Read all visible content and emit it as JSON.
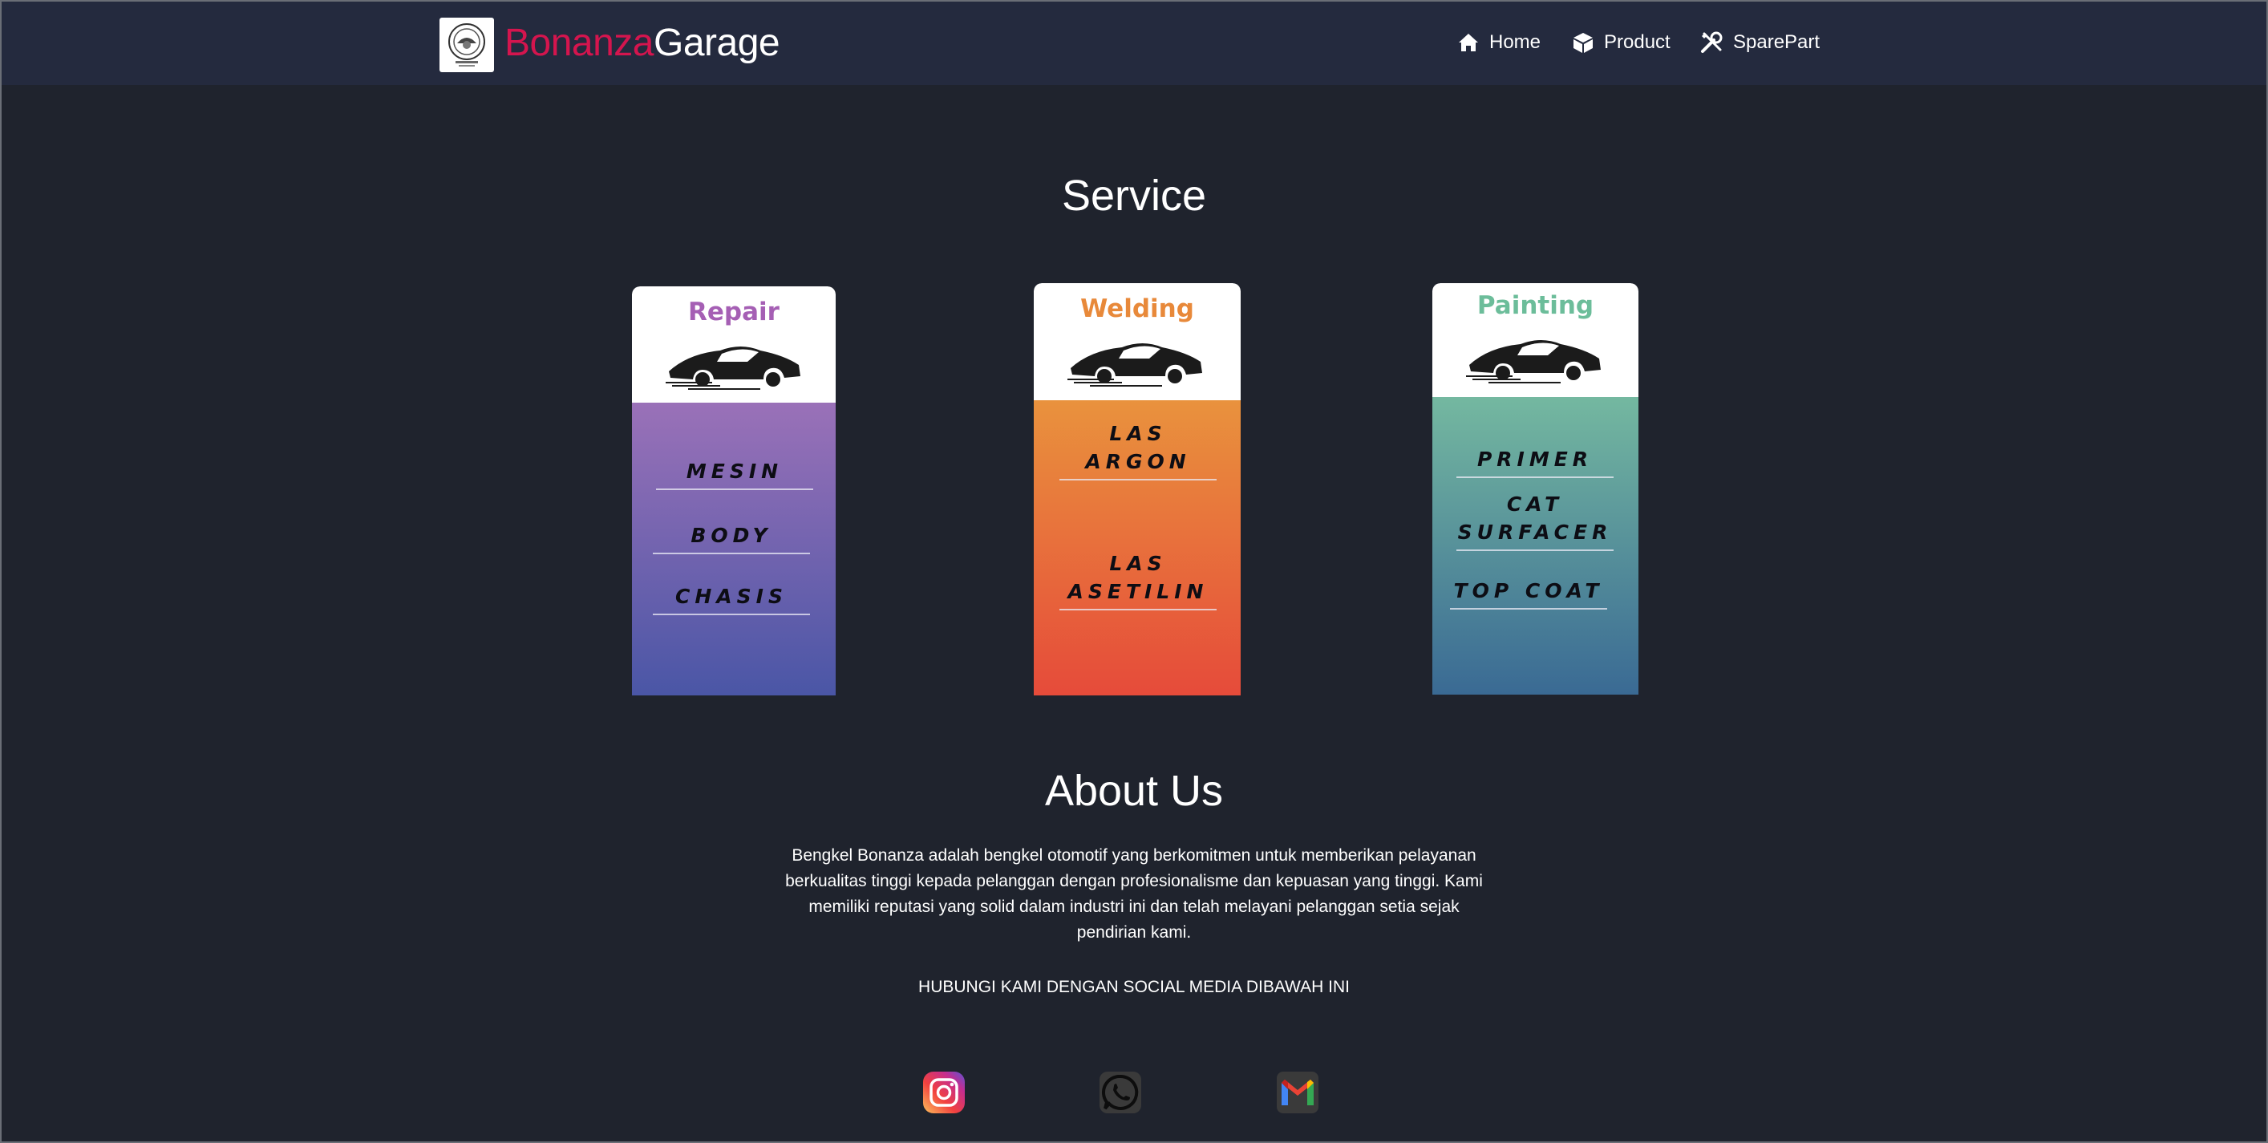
{
  "brand": {
    "part1": "Bonanza",
    "part2": "Garage",
    "accent_color": "#d4154e"
  },
  "nav": {
    "items": [
      {
        "label": "Home",
        "icon": "home-icon"
      },
      {
        "label": "Product",
        "icon": "box-icon"
      },
      {
        "label": "SparePart",
        "icon": "tools-icon"
      }
    ]
  },
  "service": {
    "title": "Service",
    "cards": [
      {
        "title": "Repair",
        "title_color": "#a55fb4",
        "icon": "car-icon",
        "items": [
          "MESIN",
          "BODY",
          "CHASIS"
        ]
      },
      {
        "title": "Welding",
        "title_color": "#e8893a",
        "icon": "car-icon",
        "items": [
          "LAS ARGON",
          "LAS ASETILIN"
        ]
      },
      {
        "title": "Painting",
        "title_color": "#6cbd9a",
        "icon": "car-icon",
        "items": [
          "PRIMER",
          "CAT SURFACER",
          "TOP COAT"
        ]
      }
    ]
  },
  "about": {
    "title": "About Us",
    "text": "Bengkel Bonanza adalah bengkel otomotif yang berkomitmen untuk memberikan pelayanan berkualitas tinggi kepada pelanggan dengan profesionalisme dan kepuasan yang tinggi. Kami memiliki reputasi yang solid dalam industri ini dan telah melayani pelanggan setia sejak pendirian kami.",
    "contact": "HUBUNGI KAMI DENGAN SOCIAL MEDIA DIBAWAH INI"
  },
  "social": [
    {
      "icon": "instagram-icon"
    },
    {
      "icon": "whatsapp-icon"
    },
    {
      "icon": "gmail-icon"
    }
  ]
}
